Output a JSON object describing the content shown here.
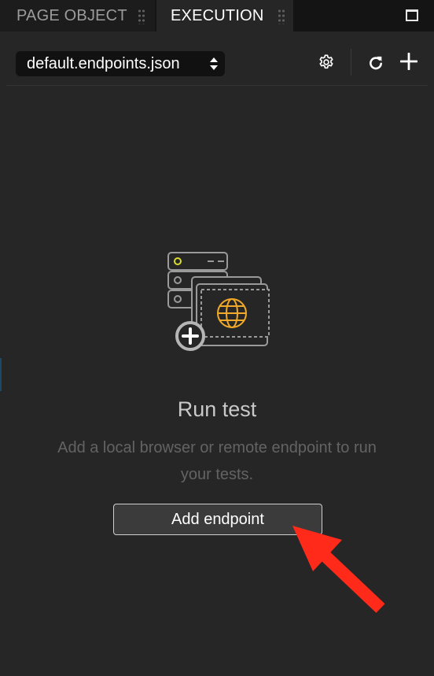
{
  "tabs": [
    {
      "label": "PAGE OBJECT",
      "active": false
    },
    {
      "label": "EXECUTION",
      "active": true
    }
  ],
  "toolbar": {
    "file_select_value": "default.endpoints.json"
  },
  "icons": {
    "maximize": "maximize-icon",
    "select_arrows": "up-down-arrows-icon",
    "settings": "gear-icon",
    "refresh": "refresh-icon",
    "add": "plus-icon",
    "illustration": "server-browser-globe-icon",
    "annotation": "red-arrow-icon"
  },
  "empty_state": {
    "title": "Run test",
    "description": "Add a local browser or remote endpoint to run your tests.",
    "button_label": "Add endpoint"
  },
  "colors": {
    "background": "#262626",
    "tabbar": "#141414",
    "accent_globe": "#f0a929",
    "status_dot": "#d7dd2c",
    "annotation_arrow": "#ff2a1a"
  }
}
